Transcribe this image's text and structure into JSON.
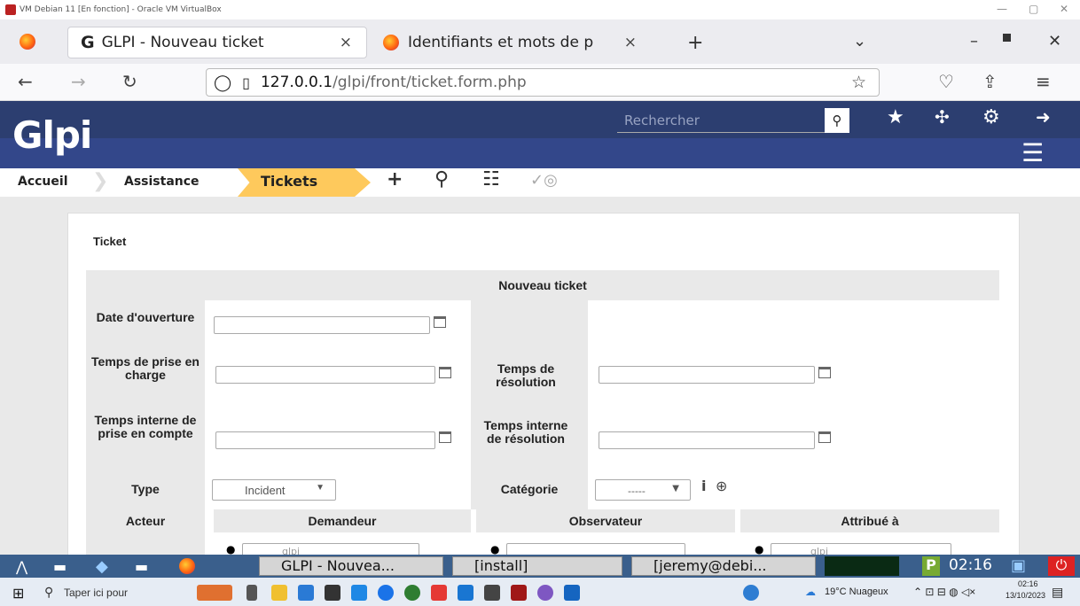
{
  "vm": {
    "title": "VM Debian 11 [En fonction] - Oracle VM VirtualBox"
  },
  "browser": {
    "tabs": [
      {
        "label": "GLPI - Nouveau ticket",
        "close": "×"
      },
      {
        "label": "Identifiants et mots de p",
        "close": "×"
      }
    ],
    "new_tab": "+",
    "url_host": "127.0.0.1",
    "url_path": "/glpi/front/ticket.form.php"
  },
  "glpi": {
    "logo": "Glpi",
    "search_placeholder": "Rechercher",
    "breadcrumb": [
      "Accueil",
      "Assistance",
      "Tickets"
    ]
  },
  "form": {
    "card_title": "Ticket",
    "header": "Nouveau ticket",
    "labels": {
      "date_ouverture": "Date d'ouverture",
      "tpc": "Temps de prise en charge",
      "tres": "Temps de résolution",
      "tipc": "Temps interne de prise en compte",
      "tires": "Temps interne de résolution",
      "type": "Type",
      "categorie": "Catégorie"
    },
    "type_value": "Incident",
    "category_value": "-----",
    "actors": {
      "acteur": "Acteur",
      "demandeur": "Demandeur",
      "observateur": "Observateur",
      "attribue": "Attribué à",
      "user_value": "glpi"
    }
  },
  "vm_taskbar": {
    "windows": [
      "GLPI - Nouvea...",
      "[install]",
      "[jeremy@debi..."
    ],
    "clock": "02:16"
  },
  "win_taskbar": {
    "search": "Taper ici pour",
    "weather": "19°C Nuageux",
    "time": "02:16",
    "date": "13/10/2023"
  }
}
